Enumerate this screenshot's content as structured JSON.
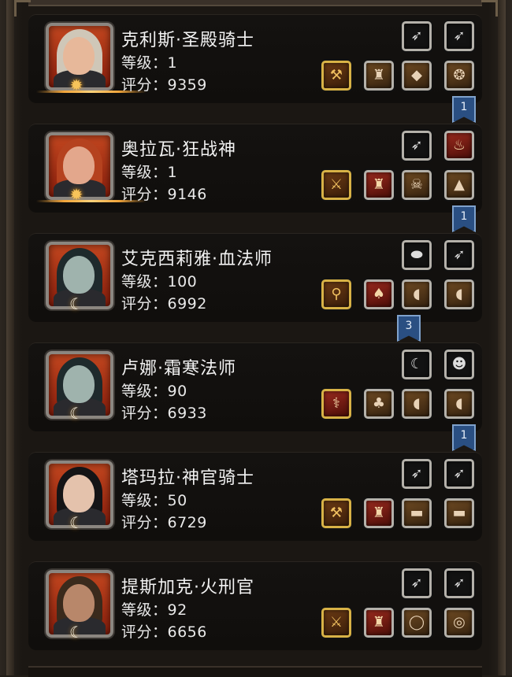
{
  "level_label": "等级：",
  "score_label": "评分：",
  "heroes": [
    {
      "name": "克利斯·圣殿骑士",
      "level": "1",
      "score": "9359",
      "emblem": "sun",
      "colors": {
        "hair": "#cfc7b8",
        "face": "#e7b89a"
      },
      "top_slots": [
        {
          "icon": "white-feather-icon",
          "glyph": "➶",
          "style": "dark"
        },
        {
          "icon": "white-feather-icon",
          "glyph": "➶",
          "style": "dark"
        }
      ],
      "bottom_slots": [
        {
          "icon": "hammer-icon",
          "glyph": "⚒",
          "style": "brown"
        },
        {
          "icon": "horned-helmet-icon",
          "glyph": "♜",
          "style": "tan"
        },
        {
          "icon": "green-gem-icon",
          "glyph": "◆",
          "style": "tan"
        },
        {
          "icon": "ornate-ring-icon",
          "glyph": "❂",
          "style": "tan"
        }
      ],
      "badge": "1"
    },
    {
      "name": "奥拉瓦·狂战神",
      "level": "1",
      "score": "9146",
      "emblem": "sun",
      "colors": {
        "hair": "#b5421f",
        "face": "#e3a78c"
      },
      "top_slots": [
        {
          "icon": "dark-feather-icon",
          "glyph": "➶",
          "style": "dark"
        },
        {
          "icon": "fire-shield-icon",
          "glyph": "♨",
          "style": "red"
        }
      ],
      "bottom_slots": [
        {
          "icon": "battle-axe-icon",
          "glyph": "⚔",
          "style": "brown"
        },
        {
          "icon": "purple-helmet-icon",
          "glyph": "♜",
          "style": "red"
        },
        {
          "icon": "skull-armor-icon",
          "glyph": "☠",
          "style": "tan"
        },
        {
          "icon": "red-cape-icon",
          "glyph": "▲",
          "style": "tan"
        }
      ],
      "badge": "1"
    },
    {
      "name": "艾克西莉雅·血法师",
      "level": "100",
      "score": "6992",
      "emblem": "moon",
      "colors": {
        "hair": "#1e2a2c",
        "face": "#9fb3ad"
      },
      "top_slots": [
        {
          "icon": "teal-stone-icon",
          "glyph": "⬬",
          "style": "dark"
        },
        {
          "icon": "dark-feather-icon",
          "glyph": "➶",
          "style": "dark"
        }
      ],
      "bottom_slots": [
        {
          "icon": "magic-wand-icon",
          "glyph": "⚲",
          "style": "brown"
        },
        {
          "icon": "red-armor-icon",
          "glyph": "♠",
          "style": "red"
        },
        {
          "icon": "leather-bracer-icon",
          "glyph": "◖",
          "style": "tan"
        },
        {
          "icon": "leather-bracer-icon",
          "glyph": "◖",
          "style": "tan"
        }
      ],
      "badge": "3"
    },
    {
      "name": "卢娜·霜寒法师",
      "level": "90",
      "score": "6933",
      "emblem": "moon",
      "colors": {
        "hair": "#1e2a2c",
        "face": "#9fb3ad"
      },
      "top_slots": [
        {
          "icon": "white-horn-icon",
          "glyph": "☾",
          "style": "dark"
        },
        {
          "icon": "mask-icon",
          "glyph": "☻",
          "style": "dark"
        }
      ],
      "bottom_slots": [
        {
          "icon": "fire-staff-icon",
          "glyph": "⚕",
          "style": "red"
        },
        {
          "icon": "dark-robe-icon",
          "glyph": "♣",
          "style": "tan"
        },
        {
          "icon": "leather-bracer-icon",
          "glyph": "◖",
          "style": "tan"
        },
        {
          "icon": "leather-bracer-icon",
          "glyph": "◖",
          "style": "tan"
        }
      ],
      "badge": "1"
    },
    {
      "name": "塔玛拉·神官骑士",
      "level": "50",
      "score": "6729",
      "emblem": "moon",
      "colors": {
        "hair": "#141416",
        "face": "#e4c2ac"
      },
      "top_slots": [
        {
          "icon": "white-feather-icon",
          "glyph": "➶",
          "style": "dark"
        },
        {
          "icon": "white-feather-icon",
          "glyph": "➶",
          "style": "dark"
        }
      ],
      "bottom_slots": [
        {
          "icon": "war-hammer-icon",
          "glyph": "⚒",
          "style": "brown"
        },
        {
          "icon": "purple-helmet-icon",
          "glyph": "♜",
          "style": "red"
        },
        {
          "icon": "belt-icon",
          "glyph": "▬",
          "style": "tan"
        },
        {
          "icon": "belt-icon",
          "glyph": "▬",
          "style": "tan"
        }
      ],
      "badge": ""
    },
    {
      "name": "提斯加克·火刑官",
      "level": "92",
      "score": "6656",
      "emblem": "moon",
      "colors": {
        "hair": "#3a2a1c",
        "face": "#b8876a"
      },
      "top_slots": [
        {
          "icon": "dark-feather-icon",
          "glyph": "➶",
          "style": "dark"
        },
        {
          "icon": "dark-feather-icon",
          "glyph": "➶",
          "style": "dark"
        }
      ],
      "bottom_slots": [
        {
          "icon": "double-axe-icon",
          "glyph": "⚔",
          "style": "brown"
        },
        {
          "icon": "purple-helmet-icon",
          "glyph": "♜",
          "style": "red"
        },
        {
          "icon": "gold-ring-icon",
          "glyph": "◯",
          "style": "tan"
        },
        {
          "icon": "blue-gem-ring-icon",
          "glyph": "◎",
          "style": "tan"
        }
      ],
      "badge": ""
    }
  ]
}
